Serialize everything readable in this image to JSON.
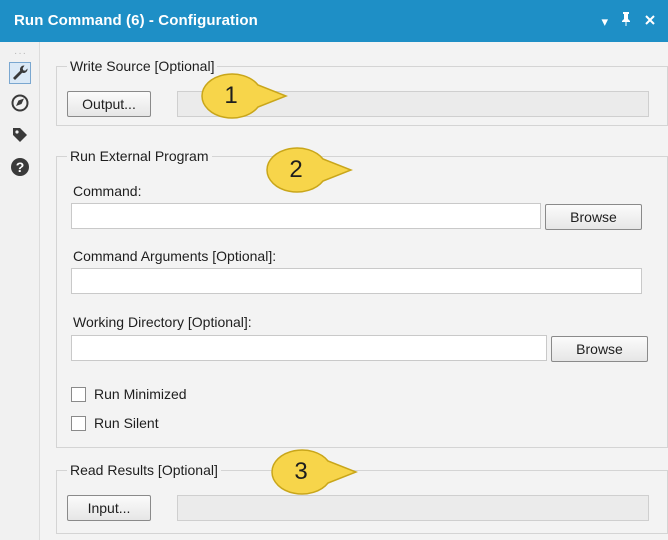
{
  "window": {
    "title": "Run Command (6) - Configuration",
    "controls": [
      "▾",
      "📌",
      "✕"
    ]
  },
  "sidebar": {
    "icons": [
      "wrench-icon",
      "compass-icon",
      "tag-icon",
      "help-icon"
    ]
  },
  "write_source": {
    "title": "Write Source [Optional]",
    "button_label": "Output...",
    "value": ""
  },
  "external_program": {
    "title": "Run External Program",
    "command_label": "Command:",
    "command_value": "",
    "browse_label": "Browse",
    "args_label": "Command Arguments [Optional]:",
    "args_value": "",
    "workdir_label": "Working Directory [Optional]:",
    "workdir_value": "",
    "workdir_browse_label": "Browse",
    "run_minimized_label": "Run Minimized",
    "run_minimized_checked": false,
    "run_silent_label": "Run Silent",
    "run_silent_checked": false
  },
  "read_results": {
    "title": "Read Results [Optional]",
    "button_label": "Input...",
    "value": ""
  },
  "callouts": [
    "1",
    "2",
    "3"
  ],
  "colors": {
    "titlebar": "#1e8fc6",
    "callout_fill": "#f7d54a",
    "callout_stroke": "#c9a61a"
  }
}
